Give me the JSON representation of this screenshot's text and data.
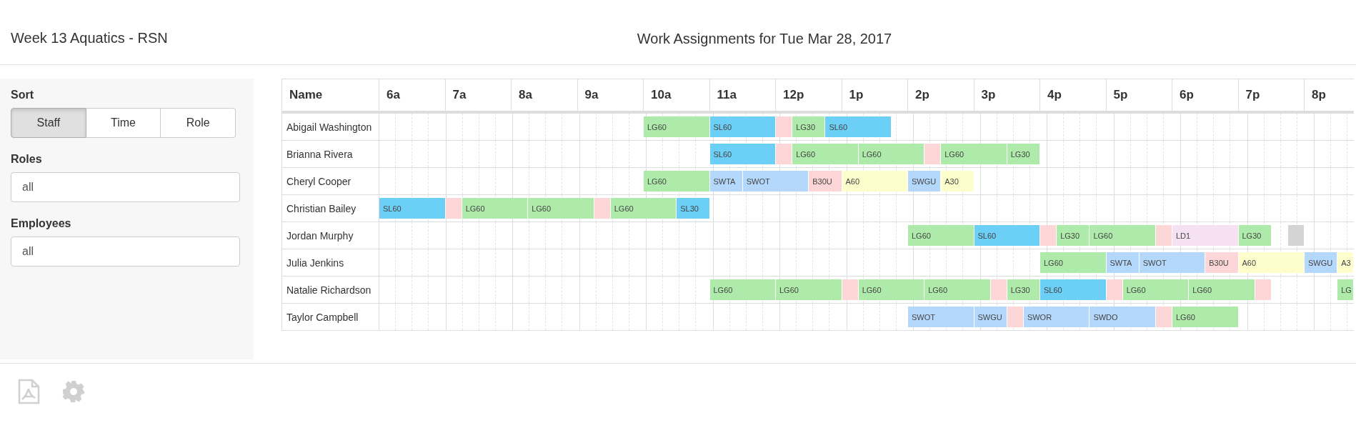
{
  "header": {
    "title": "Week 13 Aquatics - RSN",
    "subtitle": "Work Assignments for Tue Mar 28, 2017"
  },
  "sidebar": {
    "sort": {
      "label": "Sort",
      "options": [
        {
          "label": "Staff",
          "selected": true
        },
        {
          "label": "Time",
          "selected": false
        },
        {
          "label": "Role",
          "selected": false
        }
      ]
    },
    "filters": [
      {
        "label": "Roles",
        "value": "all"
      },
      {
        "label": "Employees",
        "value": "all"
      }
    ]
  },
  "schedule": {
    "name_column": "Name",
    "hours": [
      "6a",
      "7a",
      "8a",
      "9a",
      "10a",
      "11a",
      "12p",
      "1p",
      "2p",
      "3p",
      "4p",
      "5p",
      "6p",
      "7p",
      "8p"
    ],
    "rows": [
      {
        "name": "Abigail Washington",
        "slots": [
          {
            "kind": "gap-hour"
          },
          {
            "kind": "gap-hour"
          },
          {
            "kind": "gap-hour"
          },
          {
            "kind": "gap-hour"
          },
          {
            "kind": "hour",
            "code": "LG60",
            "color": "#aeeaaa"
          },
          {
            "kind": "hour",
            "code": "SL60",
            "color": "#6ccff6"
          },
          {
            "kind": "quarter-hour",
            "color": "#fdd7d7"
          },
          {
            "kind": "half-hour",
            "code": "LG30",
            "color": "#aeeaaa"
          },
          {
            "kind": "hour",
            "code": "SL60",
            "color": "#6ccff6"
          }
        ]
      },
      {
        "name": "Brianna Rivera",
        "slots": [
          {
            "kind": "gap-hour"
          },
          {
            "kind": "gap-hour"
          },
          {
            "kind": "gap-hour"
          },
          {
            "kind": "gap-hour"
          },
          {
            "kind": "gap-hour"
          },
          {
            "kind": "hour",
            "code": "SL60",
            "color": "#6ccff6"
          },
          {
            "kind": "quarter-hour",
            "color": "#fdd7d7"
          },
          {
            "kind": "hour",
            "code": "LG60",
            "color": "#aeeaaa"
          },
          {
            "kind": "hour",
            "code": "LG60",
            "color": "#aeeaaa"
          },
          {
            "kind": "quarter-hour",
            "color": "#fdd7d7"
          },
          {
            "kind": "hour",
            "code": "LG60",
            "color": "#aeeaaa"
          },
          {
            "kind": "half-hour",
            "code": "LG30",
            "color": "#aeeaaa"
          }
        ]
      },
      {
        "name": "Cheryl Cooper",
        "slots": [
          {
            "kind": "gap-hour"
          },
          {
            "kind": "gap-hour"
          },
          {
            "kind": "gap-hour"
          },
          {
            "kind": "gap-hour"
          },
          {
            "kind": "hour",
            "code": "LG60",
            "color": "#aeeaaa"
          },
          {
            "kind": "half-hour",
            "code": "SWTA",
            "color": "#b4d8fc"
          },
          {
            "kind": "hour",
            "code": "SWOT",
            "color": "#b4d8fc"
          },
          {
            "kind": "half-hour",
            "code": "B30U",
            "color": "#fdd7d7"
          },
          {
            "kind": "hour",
            "code": "A60",
            "color": "#fefdcc"
          },
          {
            "kind": "half-hour",
            "code": "SWGU",
            "color": "#b4d8fc"
          },
          {
            "kind": "half-hour",
            "code": "A30",
            "color": "#fefdcc"
          }
        ]
      },
      {
        "name": "Christian Bailey",
        "slots": [
          {
            "kind": "hour",
            "code": "SL60",
            "color": "#6ccff6"
          },
          {
            "kind": "quarter-hour",
            "color": "#fdd7d7"
          },
          {
            "kind": "hour",
            "code": "LG60",
            "color": "#aeeaaa"
          },
          {
            "kind": "hour",
            "code": "LG60",
            "color": "#aeeaaa"
          },
          {
            "kind": "quarter-hour",
            "color": "#fdd7d7"
          },
          {
            "kind": "hour",
            "code": "LG60",
            "color": "#aeeaaa"
          },
          {
            "kind": "half-hour",
            "code": "SL30",
            "color": "#6ccff6"
          }
        ]
      },
      {
        "name": "Jordan Murphy",
        "slots": [
          {
            "kind": "gap-hour"
          },
          {
            "kind": "gap-hour"
          },
          {
            "kind": "gap-hour"
          },
          {
            "kind": "gap-hour"
          },
          {
            "kind": "gap-hour"
          },
          {
            "kind": "gap-hour"
          },
          {
            "kind": "gap-hour"
          },
          {
            "kind": "gap-hour"
          },
          {
            "kind": "hour",
            "code": "LG60",
            "color": "#aeeaaa"
          },
          {
            "kind": "hour",
            "code": "SL60",
            "color": "#6ccff6"
          },
          {
            "kind": "quarter-hour",
            "color": "#fdd7d7"
          },
          {
            "kind": "half-hour",
            "code": "LG30",
            "color": "#aeeaaa"
          },
          {
            "kind": "hour",
            "code": "LG60",
            "color": "#aeeaaa"
          },
          {
            "kind": "quarter-hour",
            "color": "#fdd7d7"
          },
          {
            "kind": "hour",
            "code": "LD1",
            "color": "#f5e1f1"
          },
          {
            "kind": "half-hour",
            "code": "LG30",
            "color": "#aeeaaa"
          },
          {
            "kind": "gap-quarter"
          },
          {
            "kind": "quarter-hour",
            "color": "#d4d4d4"
          }
        ]
      },
      {
        "name": "Julia Jenkins",
        "slots": [
          {
            "kind": "gap-hour"
          },
          {
            "kind": "gap-hour"
          },
          {
            "kind": "gap-hour"
          },
          {
            "kind": "gap-hour"
          },
          {
            "kind": "gap-hour"
          },
          {
            "kind": "gap-hour"
          },
          {
            "kind": "gap-hour"
          },
          {
            "kind": "gap-hour"
          },
          {
            "kind": "gap-hour"
          },
          {
            "kind": "gap-hour"
          },
          {
            "kind": "hour",
            "code": "LG60",
            "color": "#aeeaaa"
          },
          {
            "kind": "half-hour",
            "code": "SWTA",
            "color": "#b4d8fc"
          },
          {
            "kind": "hour",
            "code": "SWOT",
            "color": "#b4d8fc"
          },
          {
            "kind": "half-hour",
            "code": "B30U",
            "color": "#fdd7d7"
          },
          {
            "kind": "hour",
            "code": "A60",
            "color": "#fefdcc"
          },
          {
            "kind": "half-hour",
            "code": "SWGU",
            "color": "#b4d8fc"
          },
          {
            "kind": "quarter-hour",
            "code": "A3",
            "color": "#fefdcc"
          }
        ]
      },
      {
        "name": "Natalie Richardson",
        "slots": [
          {
            "kind": "gap-hour"
          },
          {
            "kind": "gap-hour"
          },
          {
            "kind": "gap-hour"
          },
          {
            "kind": "gap-hour"
          },
          {
            "kind": "gap-hour"
          },
          {
            "kind": "hour",
            "code": "LG60",
            "color": "#aeeaaa"
          },
          {
            "kind": "hour",
            "code": "LG60",
            "color": "#aeeaaa"
          },
          {
            "kind": "quarter-hour",
            "color": "#fdd7d7"
          },
          {
            "kind": "hour",
            "code": "LG60",
            "color": "#aeeaaa"
          },
          {
            "kind": "hour",
            "code": "LG60",
            "color": "#aeeaaa"
          },
          {
            "kind": "quarter-hour",
            "color": "#fdd7d7"
          },
          {
            "kind": "half-hour",
            "code": "LG30",
            "color": "#aeeaaa"
          },
          {
            "kind": "hour",
            "code": "SL60",
            "color": "#6ccff6"
          },
          {
            "kind": "quarter-hour",
            "color": "#fdd7d7"
          },
          {
            "kind": "hour",
            "code": "LG60",
            "color": "#aeeaaa"
          },
          {
            "kind": "hour",
            "code": "LG60",
            "color": "#aeeaaa"
          },
          {
            "kind": "quarter-hour",
            "color": "#fdd7d7"
          },
          {
            "kind": "gap-hour"
          },
          {
            "kind": "quarter-hour",
            "code": "LG",
            "color": "#aeeaaa"
          }
        ]
      },
      {
        "name": "Taylor Campbell",
        "slots": [
          {
            "kind": "gap-hour"
          },
          {
            "kind": "gap-hour"
          },
          {
            "kind": "gap-hour"
          },
          {
            "kind": "gap-hour"
          },
          {
            "kind": "gap-hour"
          },
          {
            "kind": "gap-hour"
          },
          {
            "kind": "gap-hour"
          },
          {
            "kind": "gap-hour"
          },
          {
            "kind": "hour",
            "code": "SWOT",
            "color": "#b4d8fc"
          },
          {
            "kind": "half-hour",
            "code": "SWGU",
            "color": "#b4d8fc"
          },
          {
            "kind": "quarter-hour",
            "color": "#fdd7d7"
          },
          {
            "kind": "hour",
            "code": "SWOR",
            "color": "#b4d8fc"
          },
          {
            "kind": "hour",
            "code": "SWDO",
            "color": "#b4d8fc"
          },
          {
            "kind": "quarter-hour",
            "color": "#fdd7d7"
          },
          {
            "kind": "hour",
            "code": "LG60",
            "color": "#aeeaaa"
          }
        ]
      }
    ]
  },
  "footer": {
    "tools": [
      {
        "kind": "pdf"
      },
      {
        "kind": "settings"
      }
    ]
  }
}
